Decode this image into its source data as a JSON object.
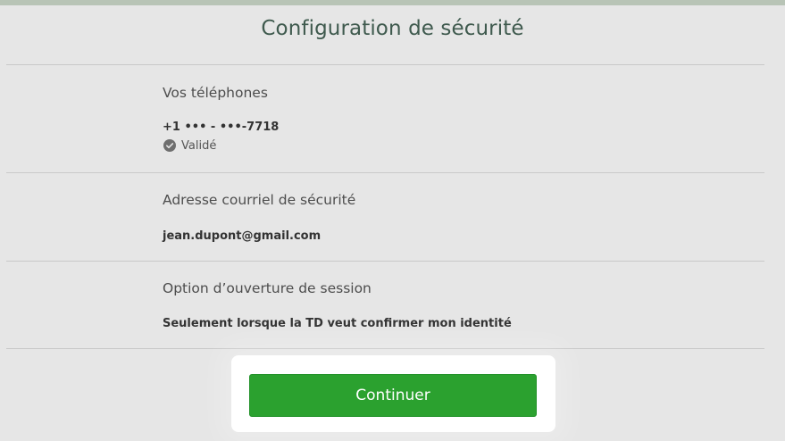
{
  "page": {
    "title": "Configuration de sécurité"
  },
  "phones": {
    "label": "Vos téléphones",
    "number": "+1 ••• - •••-7718",
    "status": "Validé",
    "status_icon": "check-circle-icon"
  },
  "email": {
    "label": "Adresse courriel de sécurité",
    "value": "jean.dupont@gmail.com"
  },
  "login_option": {
    "label": "Option d’ouverture de session",
    "value": "Seulement lorsque la TD veut confirmer mon identité"
  },
  "actions": {
    "continue_label": "Continuer"
  },
  "colors": {
    "accent": "#2ba12f",
    "title": "#3f5a4e",
    "background": "#e6e6e6"
  }
}
